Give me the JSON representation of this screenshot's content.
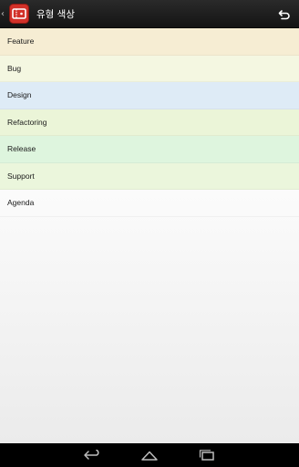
{
  "action_bar": {
    "title": "유형 색상"
  },
  "type_colors": [
    {
      "label": "Feature",
      "color": "#f6edd3"
    },
    {
      "label": "Bug",
      "color": "#f4f7e1"
    },
    {
      "label": "Design",
      "color": "#deebf6"
    },
    {
      "label": "Refactoring",
      "color": "#ebf5d8"
    },
    {
      "label": "Release",
      "color": "#def5de"
    },
    {
      "label": "Support",
      "color": "#ebf6dc"
    },
    {
      "label": "Agenda",
      "color": "transparent"
    }
  ],
  "colors": {
    "app_icon_red": "#d23129",
    "action_bar": "#1e1e1e",
    "nav_bar": "#000000",
    "nav_icon": "#bdbdbd"
  },
  "icons": {
    "up": "chevron-left-icon",
    "app": "ticket-icon",
    "undo": "undo-icon",
    "nav_back": "back-icon",
    "nav_home": "home-icon",
    "nav_recents": "recents-icon"
  }
}
